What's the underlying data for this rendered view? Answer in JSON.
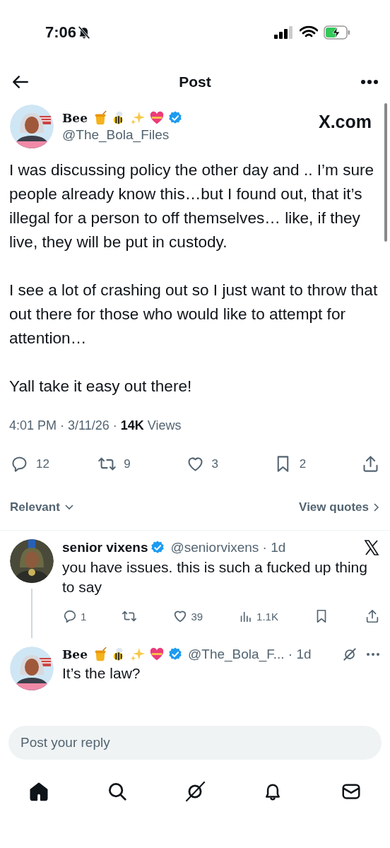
{
  "status_bar": {
    "time": "7:06"
  },
  "header": {
    "title": "Post"
  },
  "post": {
    "author": {
      "name": "Bee",
      "verified": true,
      "handle": "@The_Bola_Files"
    },
    "source": "X.com",
    "paragraphs": [
      "I was discussing policy the other day and .. I’m sure people already know this…but I found out, that it’s illegal for a person to off themselves… like, if they live, they will be put in custody.",
      "I see a lot of crashing out so I just want to throw that out there for those who would like to attempt for attention…",
      "Yall take it easy out there!"
    ],
    "meta": "4:01 PM · 3/11/26 · **14K** Views",
    "actions": [
      {
        "kind": "reply",
        "count": "12"
      },
      {
        "kind": "repost",
        "count": "9"
      },
      {
        "kind": "like",
        "count": "3"
      },
      {
        "kind": "bookmark",
        "count": "2"
      },
      {
        "kind": "share"
      }
    ]
  },
  "sort": {
    "label": "Relevant"
  },
  "view_quotes": "View quotes",
  "replies": [
    {
      "name": "senior vixens",
      "emoji": false,
      "verified": true,
      "handle": "@seniorvixens · 1d",
      "text": "you have issues. this is such a fucked up thing to say",
      "thread_line": true,
      "actions": [
        {
          "kind": "reply",
          "count": "1"
        },
        {
          "kind": "repost"
        },
        {
          "kind": "like",
          "count": "39"
        },
        {
          "kind": "views",
          "count": "1.1K"
        },
        {
          "kind": "bookmark"
        },
        {
          "kind": "share"
        }
      ]
    },
    {
      "name": "Bee",
      "emoji": true,
      "verified": true,
      "handle": "@The_Bola_F... · 1d",
      "text": "It’s the law?",
      "thread_line": false
    }
  ],
  "reply_box": {
    "placeholder": "Post your reply"
  },
  "tabs": [
    {
      "kind": "home",
      "selected": true
    },
    {
      "kind": "search",
      "selected": false
    },
    {
      "kind": "grok",
      "selected": false
    },
    {
      "kind": "notifications",
      "selected": false
    },
    {
      "kind": "messages",
      "selected": false
    }
  ]
}
